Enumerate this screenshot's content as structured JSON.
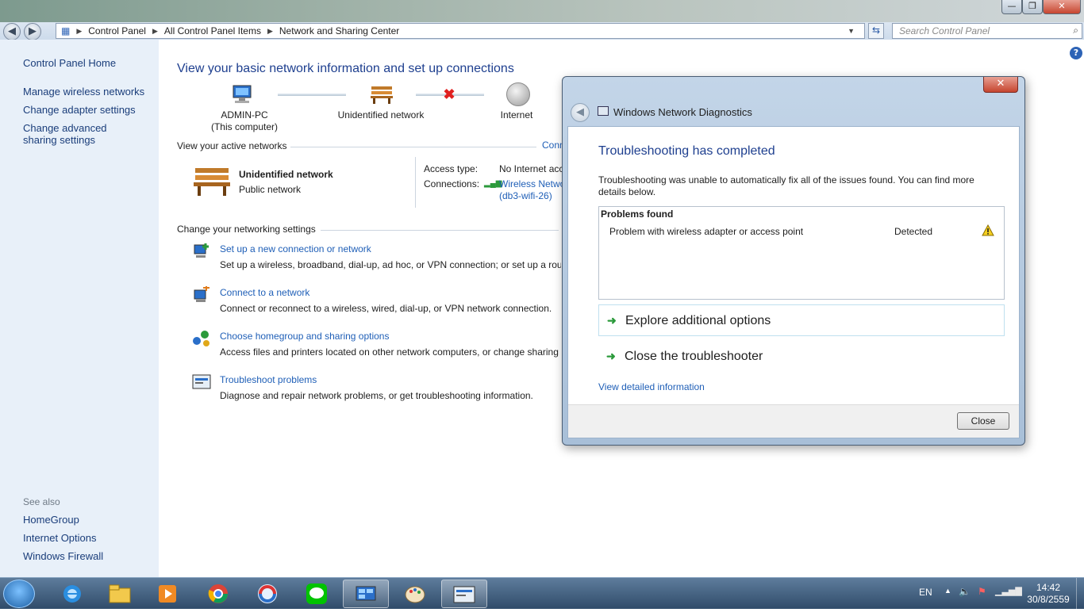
{
  "window": {
    "minimize": "—",
    "maximize": "❐",
    "close": "✕"
  },
  "address": {
    "crumbs": [
      "Control Panel",
      "All Control Panel Items",
      "Network and Sharing Center"
    ],
    "search_placeholder": "Search Control Panel"
  },
  "sidebar": {
    "home": "Control Panel Home",
    "links": [
      "Manage wireless networks",
      "Change adapter settings",
      "Change advanced sharing settings"
    ],
    "see_also_label": "See also",
    "see_also": [
      "HomeGroup",
      "Internet Options",
      "Windows Firewall"
    ]
  },
  "main": {
    "heading": "View your basic network information and set up connections",
    "map": {
      "computer_name": "ADMIN-PC",
      "computer_sub": "(This computer)",
      "network": "Unidentified network",
      "internet": "Internet"
    },
    "active_label": "View your active networks",
    "connect_link": "Conn",
    "active": {
      "name": "Unidentified network",
      "type": "Public network",
      "access_label": "Access type:",
      "access_value": "No Internet acc",
      "conn_label": "Connections:",
      "conn_value": "Wireless Netwo",
      "conn_value2": "(db3-wifi-26)"
    },
    "settings_label": "Change your networking settings",
    "tasks": [
      {
        "title": "Set up a new connection or network",
        "desc": "Set up a wireless, broadband, dial-up, ad hoc, or VPN connection; or set up a route"
      },
      {
        "title": "Connect to a network",
        "desc": "Connect or reconnect to a wireless, wired, dial-up, or VPN network connection."
      },
      {
        "title": "Choose homegroup and sharing options",
        "desc": "Access files and printers located on other network computers, or change sharing s"
      },
      {
        "title": "Troubleshoot problems",
        "desc": "Diagnose and repair network problems, or get troubleshooting information."
      }
    ]
  },
  "dialog": {
    "title": "Windows Network Diagnostics",
    "heading": "Troubleshooting has completed",
    "message": "Troubleshooting was unable to automatically fix all of the issues found. You can find more details below.",
    "problems_title": "Problems found",
    "problem": "Problem with wireless adapter or access point",
    "status": "Detected",
    "explore": "Explore additional options",
    "close_troubleshooter": "Close the troubleshooter",
    "details_link": "View detailed information",
    "close_button": "Close"
  },
  "taskbar": {
    "lang": "EN",
    "time": "14:42",
    "date": "30/8/2559"
  },
  "colors": {
    "link": "#1f5fb7",
    "heading": "#1e3f8f",
    "sidebar_bg": "#e8f0f9"
  }
}
